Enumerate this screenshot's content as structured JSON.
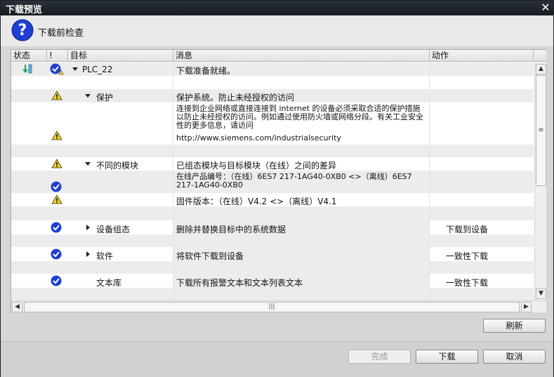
{
  "window": {
    "title": "下载预览"
  },
  "header": {
    "title": "下载前检查",
    "icon": "help-icon"
  },
  "table": {
    "columns": {
      "status": "状态",
      "warn": "!",
      "target": "目标",
      "message": "消息",
      "action": "动作"
    },
    "rows": {
      "plc": {
        "target": "PLC_22",
        "message": "下载准备就绪。",
        "action": ""
      },
      "protect": {
        "target": "保护",
        "message": "保护系统。防止未经授权的访问"
      },
      "protect_detail": {
        "message": "连接到企业网络或直接连接到 internet 的设备必须采取合适的保护措施以防止未经授权的访问。例如通过使用防火墙或网络分段。有关工业安全性的更多信息，请访问",
        "url": "http://www.siemens.com/industrialsecurity"
      },
      "diff": {
        "target": "不同的模块",
        "message": "已组态模块与目标模块（在线）之间的差异"
      },
      "diff_order": {
        "message": "在线产品编号：（在线）6ES7 217-1AG40-0XB0 <>（离线）6ES7 217-1AG40-0XB0"
      },
      "diff_fw": {
        "message": "固件版本：（在线）V4.2 <>（离线）V4.1"
      },
      "hwconfig": {
        "target": "设备组态",
        "message": "删除并替换目标中的系统数据",
        "action": "下载到设备"
      },
      "software": {
        "target": "软件",
        "message": "将软件下载到设备",
        "action": "一致性下载"
      },
      "textlib": {
        "target": "文本库",
        "message": "下载所有报警文本和文本列表文本",
        "action": "一致性下载"
      }
    }
  },
  "buttons": {
    "refresh": "刷新",
    "finish": "完成",
    "download": "下载",
    "cancel": "取消"
  },
  "colors": {
    "check_blue": "#1f3fd1",
    "warn_yellow": "#f2d21b",
    "title_bar": "#1d2329"
  }
}
